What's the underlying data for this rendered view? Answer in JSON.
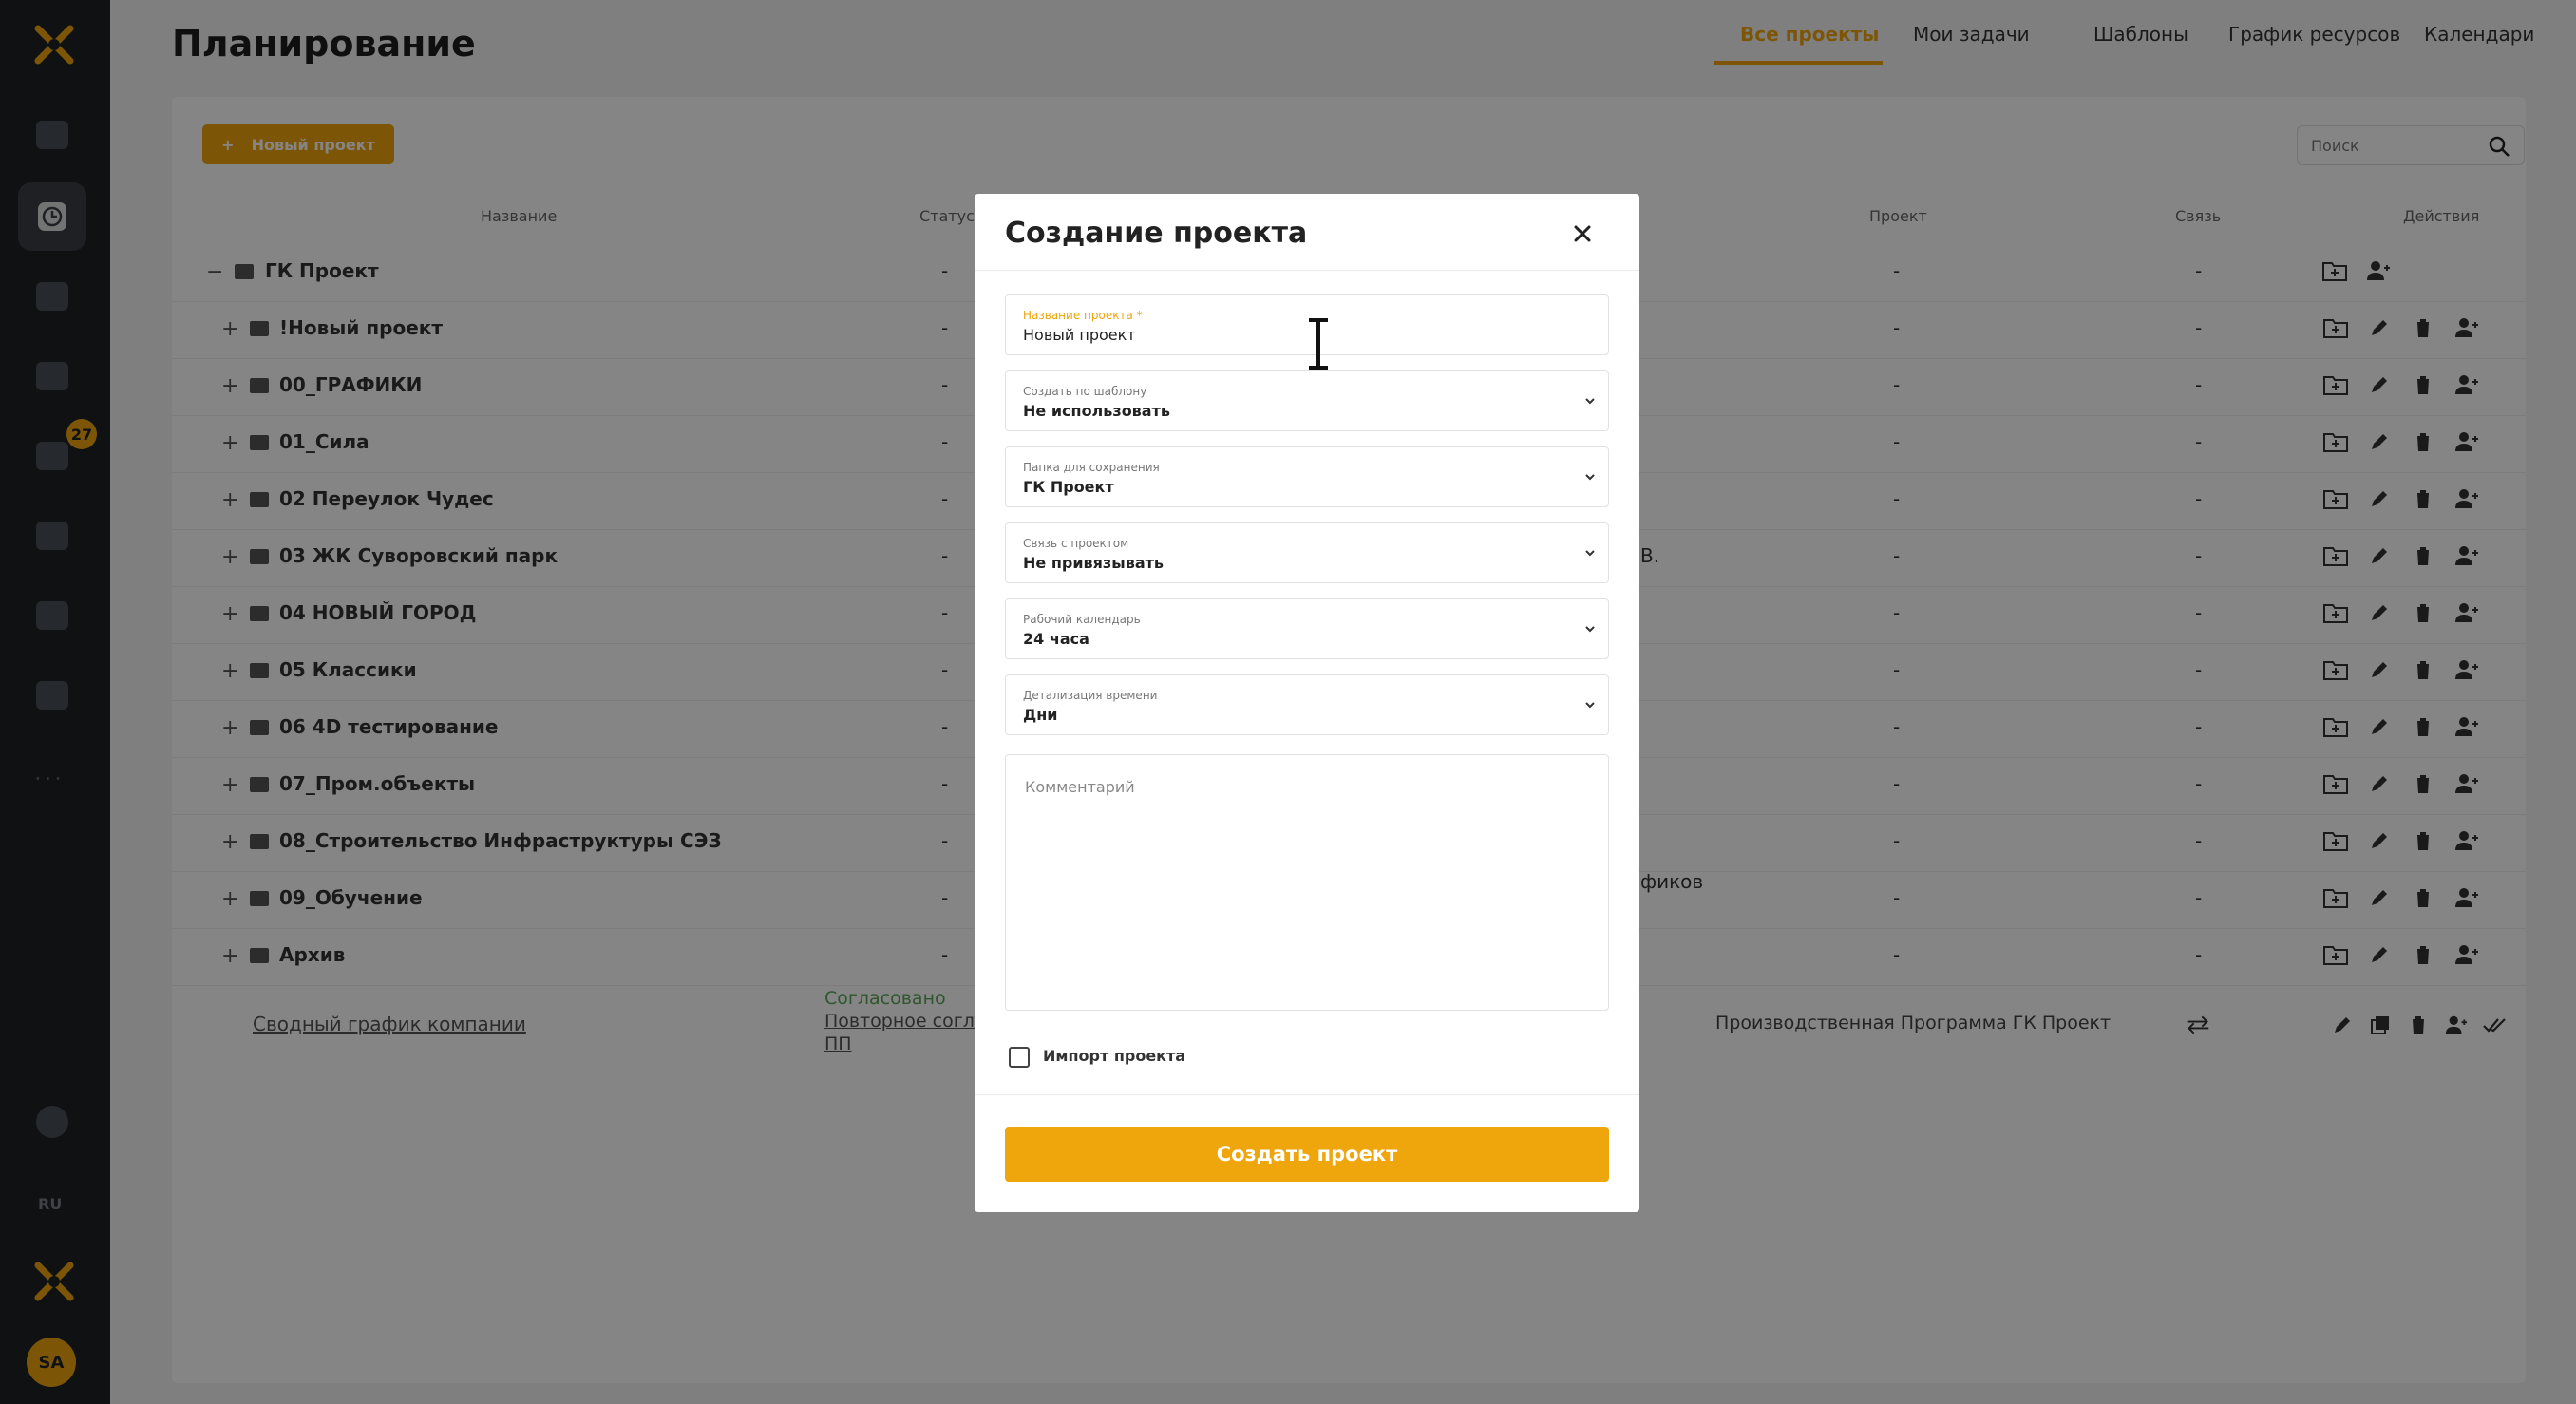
{
  "app": {
    "title": "Планирование",
    "accent_color": "#eea60c",
    "sidebar": {
      "badge": "27",
      "dots": "···",
      "lang": "RU",
      "avatar": "SA"
    },
    "nav": [
      {
        "label": "Все проекты",
        "active": true
      },
      {
        "label": "Мои задачи",
        "active": false
      },
      {
        "label": "Шаблоны",
        "active": false
      },
      {
        "label": "График ресурсов",
        "active": false
      },
      {
        "label": "Календари",
        "active": false
      }
    ]
  },
  "toolbar": {
    "new_project_label": "Новый проект",
    "new_project_plus": "+",
    "search_placeholder": "Поиск"
  },
  "table": {
    "headers": {
      "name": "Название",
      "status": "Статус",
      "project": "Проект",
      "link": "Связь",
      "actions": "Действия"
    },
    "root": {
      "toggle": "−",
      "name": "ГК Проект",
      "status": "-",
      "project": "-",
      "link": "-"
    },
    "rows": [
      {
        "toggle": "+",
        "name": "!Новый проект",
        "status": "-",
        "project": "-",
        "link": "-"
      },
      {
        "toggle": "+",
        "name": "00_ГРАФИКИ",
        "status": "-",
        "project": "-",
        "link": "-"
      },
      {
        "toggle": "+",
        "name": "01_Сила",
        "status": "-",
        "project": "-",
        "link": "-"
      },
      {
        "toggle": "+",
        "name": "02 Переулок Чудес",
        "status": "-",
        "project": "-",
        "link": "-"
      },
      {
        "toggle": "+",
        "name": "03 ЖК Суворовский парк",
        "status": "-",
        "project": "-",
        "link": "-"
      },
      {
        "toggle": "+",
        "name": "04 НОВЫЙ ГОРОД",
        "status": "-",
        "project": "-",
        "link": "-"
      },
      {
        "toggle": "+",
        "name": "05 Классики",
        "status": "-",
        "project": "-",
        "link": "-"
      },
      {
        "toggle": "+",
        "name": "06 4D тестирование",
        "status": "-",
        "project": "-",
        "link": "-"
      },
      {
        "toggle": "+",
        "name": "07_Пром.объекты",
        "status": "-",
        "project": "-",
        "link": "-"
      },
      {
        "toggle": "+",
        "name": "08_Строительство Инфраструктуры СЭЗ",
        "status": "-",
        "project": "-",
        "link": "-"
      },
      {
        "toggle": "+",
        "name": "09_Обучение",
        "status": "-",
        "project": "-",
        "link": "-"
      },
      {
        "toggle": "+",
        "name": "Архив",
        "status": "-",
        "project": "-",
        "link": "-"
      }
    ],
    "row_fragments": {
      "row_03": "В.",
      "row_09": "фиков"
    },
    "schedule_row": {
      "name": "Сводный график компании",
      "status_approved": "Согласовано",
      "status_repeat": "Повторное согласо",
      "status_pp": "ПП",
      "project": "Производственная Программа ГК Проект"
    }
  },
  "modal": {
    "title": "Создание проекта",
    "fields": [
      {
        "label": "Название проекта *",
        "value": "Новый проект",
        "dropdown": false,
        "focused": true
      },
      {
        "label": "Создать по шаблону",
        "value": "Не использовать",
        "dropdown": true
      },
      {
        "label": "Папка для сохранения",
        "value": "ГК Проект",
        "dropdown": true
      },
      {
        "label": "Связь с проектом",
        "value": "Не привязывать",
        "dropdown": true
      },
      {
        "label": "Рабочий календарь",
        "value": "24 часа",
        "dropdown": true
      },
      {
        "label": "Детализация времени",
        "value": "Дни",
        "dropdown": true
      }
    ],
    "comment_placeholder": "Комментарий",
    "import_label": "Импорт проекта",
    "import_checked": false,
    "submit_label": "Создать проект"
  }
}
